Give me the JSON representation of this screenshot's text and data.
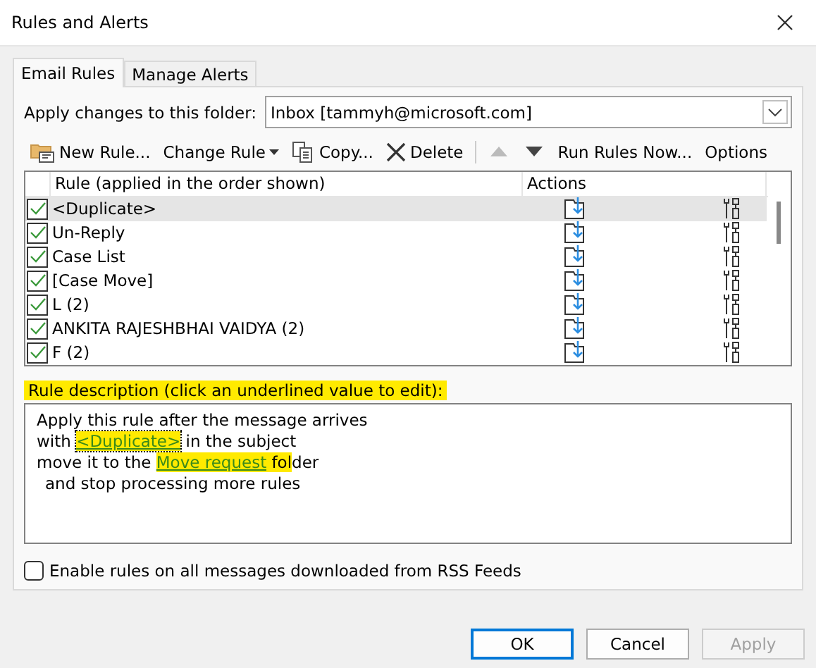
{
  "window": {
    "title": "Rules and Alerts"
  },
  "tabs": [
    {
      "label": "Email Rules",
      "selected": true
    },
    {
      "label": "Manage Alerts",
      "selected": false
    }
  ],
  "folder": {
    "label": "Apply changes to this folder:",
    "value": "Inbox [tammyh@microsoft.com]"
  },
  "toolbar": [
    {
      "kind": "new",
      "label": "New Rule...",
      "disabled": false
    },
    {
      "kind": "change",
      "label": "Change Rule",
      "disabled": false
    },
    {
      "kind": "copy",
      "label": "Copy...",
      "disabled": false
    },
    {
      "kind": "delete",
      "label": "Delete",
      "disabled": false
    },
    {
      "kind": "up",
      "disabled": true
    },
    {
      "kind": "down",
      "disabled": false
    },
    {
      "kind": "run",
      "label": "Run Rules Now...",
      "disabled": false
    },
    {
      "kind": "options",
      "label": "Options",
      "disabled": false
    }
  ],
  "table": {
    "columns": [
      "Rule (applied in the order shown)",
      "Actions"
    ],
    "rows": [
      {
        "name": "<Duplicate>",
        "checked": true,
        "selected": true
      },
      {
        "name": "Un-Reply",
        "checked": true,
        "selected": false
      },
      {
        "name": "Case List",
        "checked": true,
        "selected": false
      },
      {
        "name": "[Case Move]",
        "checked": true,
        "selected": false
      },
      {
        "name": "L (2)",
        "checked": true,
        "selected": false
      },
      {
        "name": "ANKITA RAJESHBHAI VAIDYA (2)",
        "checked": true,
        "selected": false
      },
      {
        "name": "F (2)",
        "checked": true,
        "selected": false
      }
    ]
  },
  "description": {
    "label": "Rule description (click an underlined value to edit):",
    "label_highlighted": true,
    "lines": [
      {
        "indent": false,
        "segments": [
          {
            "kind": "text",
            "text": "Apply this rule after the message arrives",
            "highlighted": false
          }
        ]
      },
      {
        "indent": false,
        "segments": [
          {
            "kind": "text",
            "text": "with ",
            "highlighted": false
          },
          {
            "kind": "value",
            "text": "<Duplicate>",
            "highlighted": true,
            "focused": true
          },
          {
            "kind": "text",
            "text": " in the subject",
            "highlighted": false
          }
        ]
      },
      {
        "indent": false,
        "segments": [
          {
            "kind": "text",
            "text": "move it to the ",
            "highlighted": false
          },
          {
            "kind": "value",
            "text": "Move request",
            "highlighted": true,
            "focused": false
          },
          {
            "kind": "text",
            "text": " fol",
            "highlighted": true
          },
          {
            "kind": "text",
            "text": "der",
            "highlighted": false
          }
        ]
      },
      {
        "indent": true,
        "segments": [
          {
            "kind": "text",
            "text": "and stop processing more rules",
            "highlighted": false
          }
        ]
      }
    ]
  },
  "rss": {
    "label": "Enable rules on all messages downloaded from RSS Feeds",
    "checked": false
  },
  "buttons": [
    {
      "label": "OK",
      "default": true,
      "disabled": false
    },
    {
      "label": "Cancel",
      "default": false,
      "disabled": false
    },
    {
      "label": "Apply",
      "default": false,
      "disabled": true
    }
  ]
}
